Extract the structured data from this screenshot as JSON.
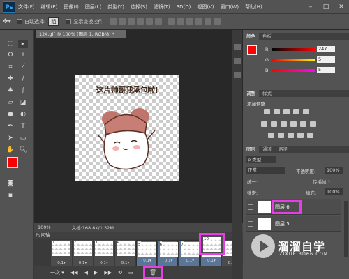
{
  "app": {
    "logo": "Ps"
  },
  "menu": [
    "文件(F)",
    "编辑(E)",
    "图像(I)",
    "图层(L)",
    "类型(Y)",
    "选择(S)",
    "滤镜(T)",
    "3D(D)",
    "视图(V)",
    "窗口(W)",
    "帮助(H)"
  ],
  "window_controls": [
    "–",
    "□",
    "✕"
  ],
  "options": {
    "auto_select_label": "自动选择:",
    "auto_select_value": "组",
    "show_transform_label": "显示变换控件"
  },
  "document": {
    "tab_title": "124.gif @ 100% (图层 1, RGB/8) *",
    "caption": "这片帅哥我承包啦!"
  },
  "status": {
    "zoom": "100%",
    "doc_info": "文档:168.8K/1.32M"
  },
  "timeline": {
    "title": "时间轴",
    "frames": [
      {
        "num": "1",
        "delay": "0.1▾"
      },
      {
        "num": "2",
        "delay": "0.1▾"
      },
      {
        "num": "3",
        "delay": "0.1▾"
      },
      {
        "num": "4",
        "delay": "0.1▾"
      },
      {
        "num": "5",
        "delay": "0.1▾"
      },
      {
        "num": "6",
        "delay": "0.1▾"
      },
      {
        "num": "7",
        "delay": "0.1▾"
      },
      {
        "num": "8",
        "delay": "0.1▾"
      },
      {
        "num": "9",
        "delay": "0.1▾"
      },
      {
        "num": "10",
        "delay": "0.1▾"
      }
    ],
    "controls": [
      "一次 ▾",
      "◀◀",
      "◀",
      "▶",
      "▶▶",
      "⟲",
      "▭",
      "🗑"
    ]
  },
  "color_panel": {
    "tabs": [
      "颜色",
      "色板"
    ],
    "r_label": "R",
    "g_label": "G",
    "b_label": "B",
    "r": "247",
    "g": "5",
    "b": "5",
    "fg": "#f70505"
  },
  "adjust_panel": {
    "tabs": [
      "调整",
      "样式"
    ],
    "title": "添加调整"
  },
  "layers_panel": {
    "tabs": [
      "图层",
      "通道",
      "路径"
    ],
    "kind": "ρ 类型",
    "blend": "正常",
    "opacity_label": "不透明度:",
    "opacity": "100%",
    "unify": "统一:",
    "propagate": "传播帧 1",
    "lock": "锁定:",
    "fill_label": "填充:",
    "fill": "100%",
    "layers": [
      {
        "name": "图层 6"
      },
      {
        "name": "图层 5"
      }
    ]
  },
  "watermark": {
    "title": "溜溜自学",
    "sub": "ZIXUE.3D66.COM"
  }
}
